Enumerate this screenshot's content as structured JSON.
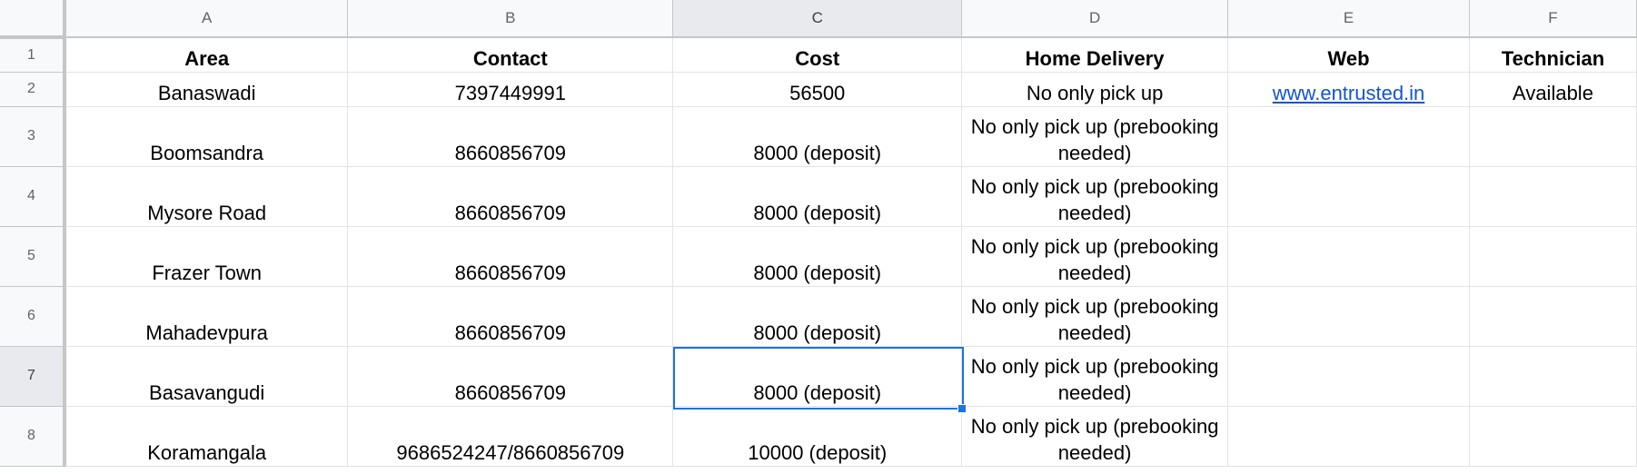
{
  "columns": [
    "A",
    "B",
    "C",
    "D",
    "E",
    "F"
  ],
  "selected_column": "C",
  "selected_row": "7",
  "rows": [
    {
      "num": "1",
      "cells": [
        "Area",
        "Contact",
        "Cost",
        "Home Delivery",
        "Web",
        "Technician"
      ]
    },
    {
      "num": "2",
      "cells": [
        "Banaswadi",
        "7397449991",
        "56500",
        "No only pick up",
        "www.entrusted.in",
        "Available"
      ]
    },
    {
      "num": "3",
      "cells": [
        "Boomsandra",
        "8660856709",
        "8000 (deposit)",
        "No only pick up (prebooking needed)",
        "",
        ""
      ]
    },
    {
      "num": "4",
      "cells": [
        "Mysore Road",
        "8660856709",
        "8000 (deposit)",
        "No only pick up (prebooking needed)",
        "",
        ""
      ]
    },
    {
      "num": "5",
      "cells": [
        "Frazer Town",
        "8660856709",
        "8000 (deposit)",
        "No only pick up (prebooking needed)",
        "",
        ""
      ]
    },
    {
      "num": "6",
      "cells": [
        "Mahadevpura",
        "8660856709",
        "8000 (deposit)",
        "No only pick up (prebooking needed)",
        "",
        ""
      ]
    },
    {
      "num": "7",
      "cells": [
        "Basavangudi",
        "8660856709",
        "8000 (deposit)",
        "No only pick up (prebooking needed)",
        "",
        ""
      ]
    },
    {
      "num": "8",
      "cells": [
        "Koramangala",
        "9686524247/8660856709",
        "10000 (deposit)",
        "No only pick up (prebooking needed)",
        "",
        ""
      ]
    }
  ],
  "colors": {
    "selection": "#1a73e8",
    "link": "#1155cc",
    "header_bg": "#f8f9fa"
  }
}
